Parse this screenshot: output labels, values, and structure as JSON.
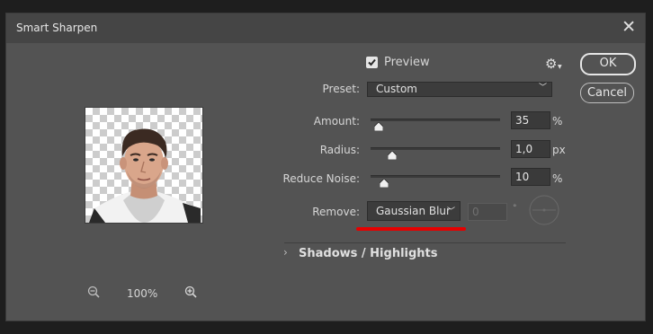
{
  "dialog": {
    "title": "Smart Sharpen"
  },
  "preview": {
    "checkbox_label": "Preview",
    "checked": true,
    "zoom_level": "100%"
  },
  "buttons": {
    "ok": "OK",
    "cancel": "Cancel"
  },
  "preset": {
    "label": "Preset:",
    "value": "Custom"
  },
  "amount": {
    "label": "Amount:",
    "value": "35",
    "unit": "%",
    "fraction": 0.07
  },
  "radius": {
    "label": "Radius:",
    "value": "1,0",
    "unit": "px",
    "fraction": 0.14
  },
  "reduce_noise": {
    "label": "Reduce Noise:",
    "value": "10",
    "unit": "%",
    "fraction": 0.1
  },
  "remove": {
    "label": "Remove:",
    "value": "Gaussian Blur",
    "angle_value": "0",
    "angle_unit": "°"
  },
  "section": {
    "label": "Shadows / Highlights",
    "expanded": false
  },
  "colors": {
    "annotation_underline": "#e60000",
    "dialog_bg": "#535353",
    "titlebar_bg": "#454545"
  },
  "icons": [
    "close-icon",
    "checkmark-icon",
    "gear-icon",
    "zoom-out-icon",
    "zoom-in-icon",
    "chevron-down-icon",
    "chevron-right-icon",
    "angle-dial-icon"
  ]
}
